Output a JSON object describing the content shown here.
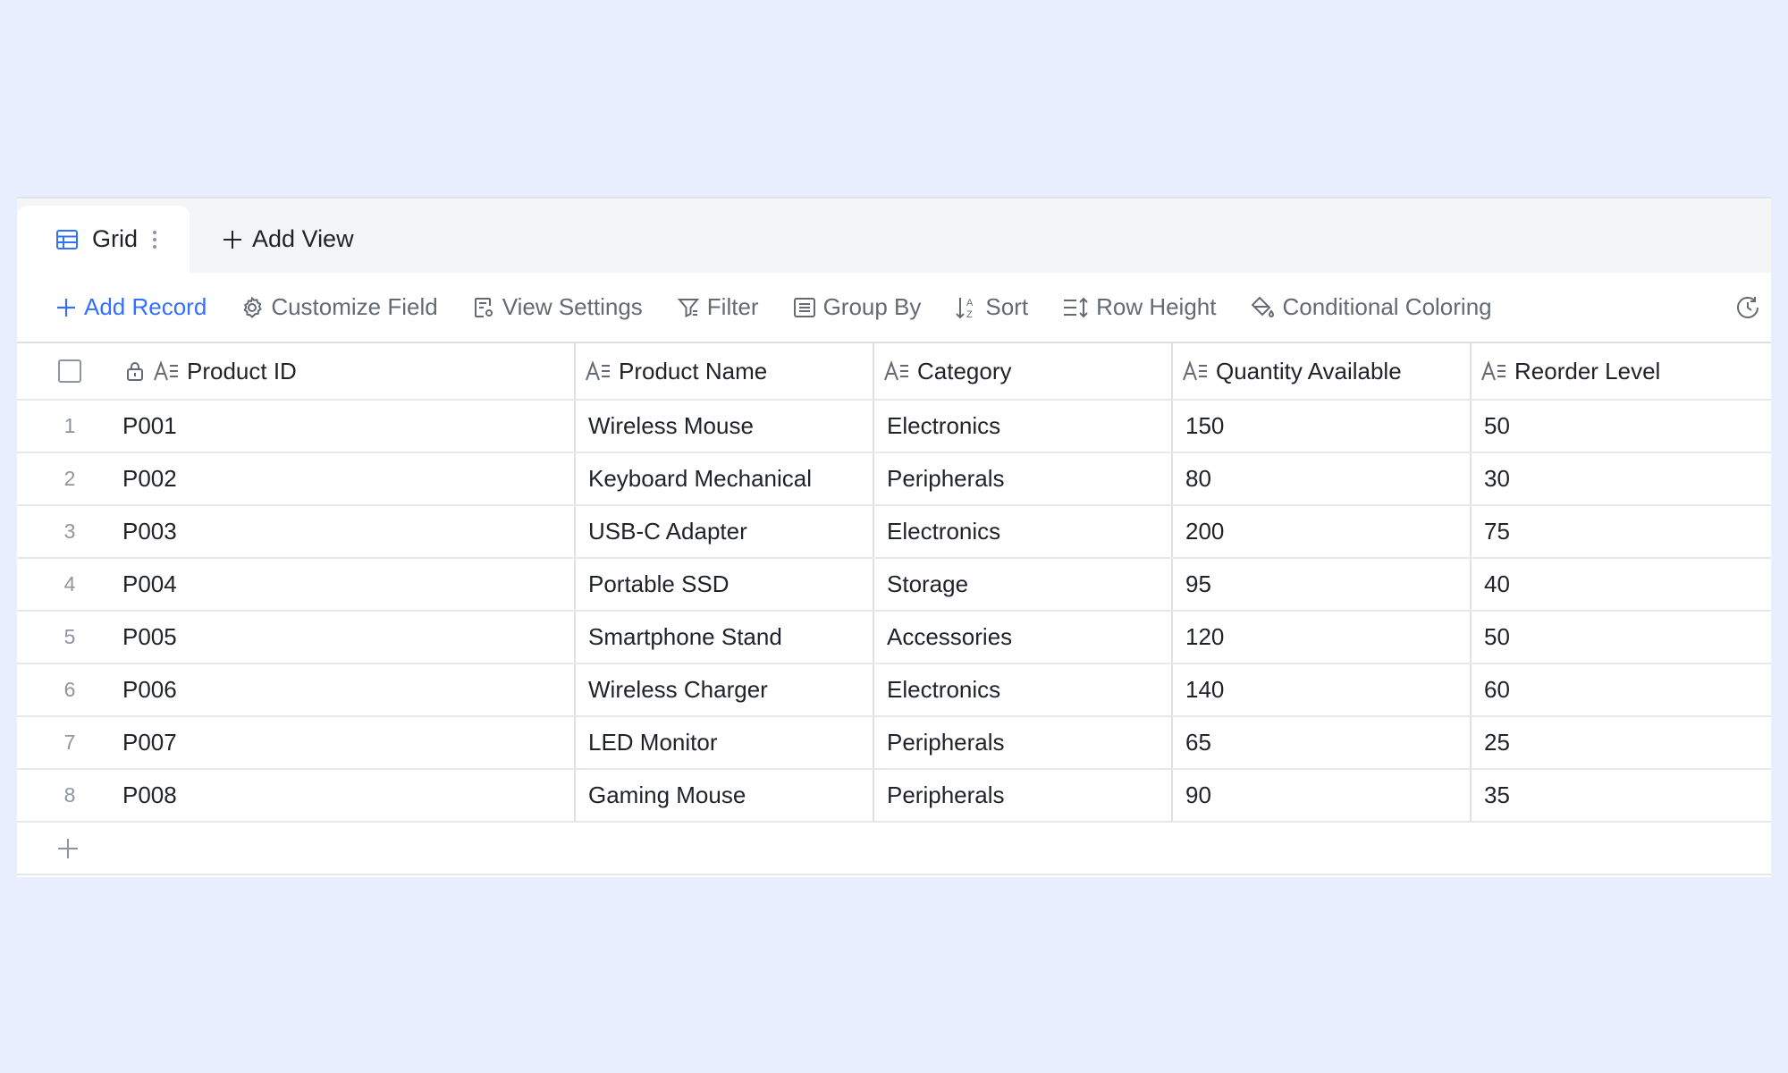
{
  "tabs": {
    "active_label": "Grid",
    "add_view_label": "Add View"
  },
  "toolbar": {
    "add_record": "Add Record",
    "customize_field": "Customize Field",
    "view_settings": "View Settings",
    "filter": "Filter",
    "group_by": "Group By",
    "sort": "Sort",
    "row_height": "Row Height",
    "conditional_coloring": "Conditional Coloring"
  },
  "table": {
    "columns": [
      "Product ID",
      "Product Name",
      "Category",
      "Quantity Available",
      "Reorder Level"
    ],
    "rows": [
      {
        "num": "1",
        "id": "P001",
        "name": "Wireless Mouse",
        "category": "Electronics",
        "qty": "150",
        "reorder": "50"
      },
      {
        "num": "2",
        "id": "P002",
        "name": "Keyboard Mechanical",
        "category": "Peripherals",
        "qty": "80",
        "reorder": "30"
      },
      {
        "num": "3",
        "id": "P003",
        "name": "USB-C Adapter",
        "category": "Electronics",
        "qty": "200",
        "reorder": "75"
      },
      {
        "num": "4",
        "id": "P004",
        "name": "Portable SSD",
        "category": "Storage",
        "qty": "95",
        "reorder": "40"
      },
      {
        "num": "5",
        "id": "P005",
        "name": "Smartphone Stand",
        "category": "Accessories",
        "qty": "120",
        "reorder": "50"
      },
      {
        "num": "6",
        "id": "P006",
        "name": "Wireless Charger",
        "category": "Electronics",
        "qty": "140",
        "reorder": "60"
      },
      {
        "num": "7",
        "id": "P007",
        "name": "LED Monitor",
        "category": "Peripherals",
        "qty": "65",
        "reorder": "25"
      },
      {
        "num": "8",
        "id": "P008",
        "name": "Gaming Mouse",
        "category": "Peripherals",
        "qty": "90",
        "reorder": "35"
      }
    ]
  },
  "colors": {
    "accent": "#3370ff",
    "background": "#e8eefd"
  }
}
